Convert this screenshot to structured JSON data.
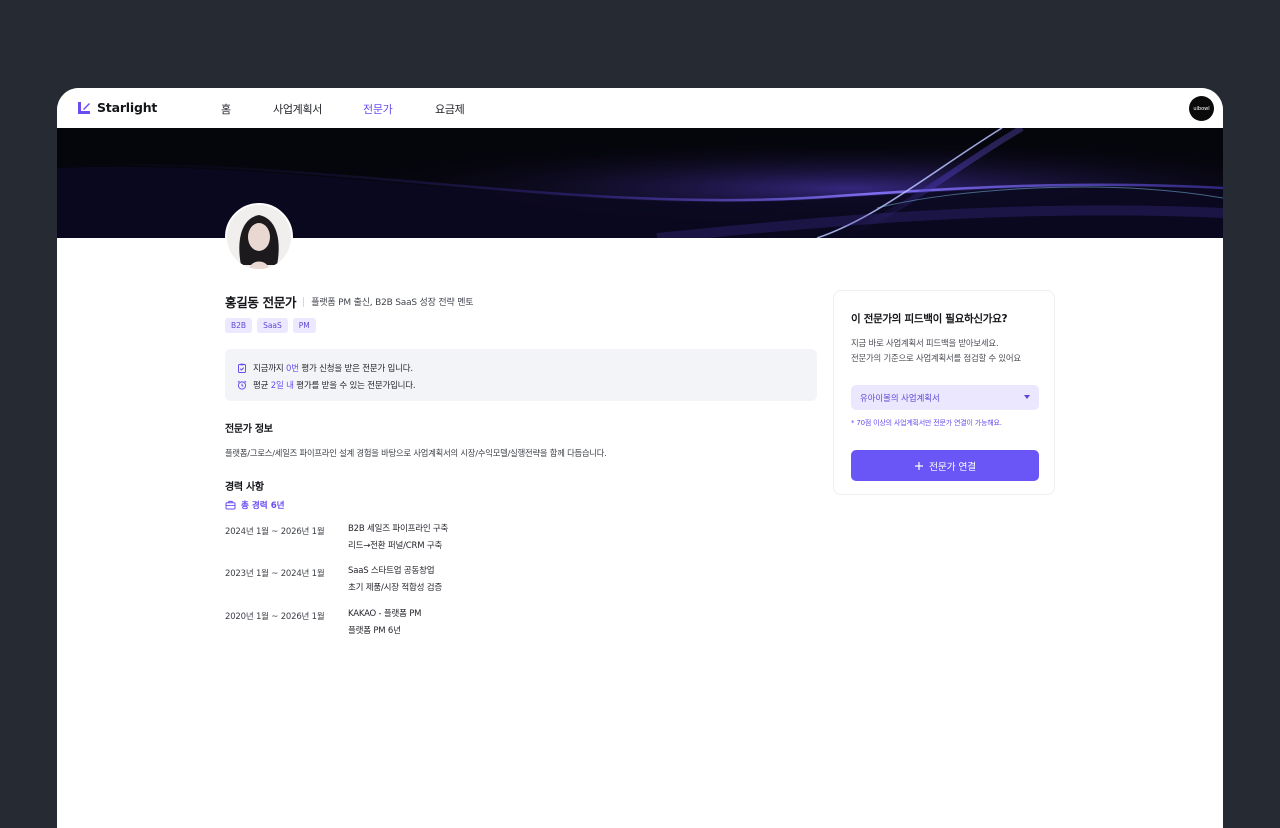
{
  "nav": {
    "brand": "Starlight",
    "items": [
      {
        "label": "홈",
        "active": false
      },
      {
        "label": "사업계획서",
        "active": false
      },
      {
        "label": "전문가",
        "active": true
      },
      {
        "label": "요금제",
        "active": false
      }
    ],
    "user_badge": "uibowl"
  },
  "profile": {
    "name": "홍길동 전문가",
    "subtitle": "플랫폼 PM 출신, B2B SaaS 성장 전략 멘토",
    "tags": [
      "B2B",
      "SaaS",
      "PM"
    ]
  },
  "stats": {
    "line1_prefix": "지금까지",
    "line1_highlight": "0번",
    "line1_suffix": "평가 신청을 받은 전문가 입니다.",
    "line2_prefix": "평균",
    "line2_highlight": "2일 내",
    "line2_suffix": "평가를 받을 수 있는 전문가입니다."
  },
  "expert_info": {
    "title": "전문가 정보",
    "description": "플랫폼/그로스/세일즈 파이프라인 설계 경험을 바탕으로 사업계획서의 시장/수익모델/실행전략을 함께 다듬습니다."
  },
  "career": {
    "title": "경력 사항",
    "total": "총 경력 6년",
    "entries": [
      {
        "period": "2024년 1월 ~ 2026년 1월",
        "role": "B2B 세일즈 파이프라인 구축",
        "detail": "리드→전환 퍼널/CRM 구축"
      },
      {
        "period": "2023년 1월 ~ 2024년 1월",
        "role": "SaaS 스타트업 공동창업",
        "detail": "초기 제품/시장 적합성 검증"
      },
      {
        "period": "2020년 1월 ~ 2026년 1월",
        "role": "KAKAO - 플랫폼 PM",
        "detail": "플랫폼 PM 6년"
      }
    ]
  },
  "request_card": {
    "title": "이 전문가의 피드백이 필요하신가요?",
    "desc_line1": "지금 바로 사업계획서 피드백을 받아보세요.",
    "desc_line2": "전문가의 기준으로 사업계획서를 점검할 수 있어요",
    "select_value": "유아이볼의 사업계획서",
    "note": "* 70점 이상의 사업계획서만 전문가 연결이 가능해요.",
    "button_label": "전문가 연결"
  },
  "colors": {
    "accent": "#6a4cf0",
    "button": "#6a55f6",
    "tag_bg": "#ece8ff",
    "page_bg": "#262a33"
  }
}
